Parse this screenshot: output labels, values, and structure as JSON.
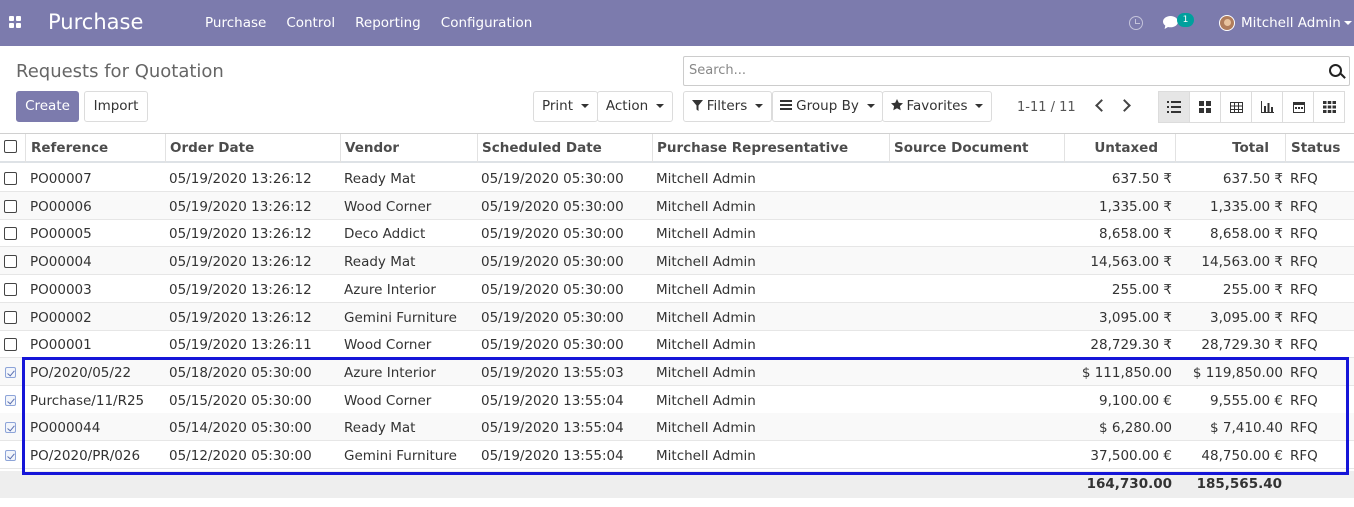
{
  "app": {
    "name": "Purchase",
    "menu": [
      "Purchase",
      "Control",
      "Reporting",
      "Configuration"
    ],
    "user": "Mitchell Admin",
    "chat_badge": "1",
    "brand_color": "#7c7bad"
  },
  "page": {
    "title": "Requests for Quotation",
    "create_label": "Create",
    "import_label": "Import",
    "print_label": "Print",
    "action_label": "Action",
    "search_placeholder": "Search...",
    "filters_label": "Filters",
    "groupby_label": "Group By",
    "favorites_label": "Favorites",
    "pager": "1-11 / 11"
  },
  "table": {
    "columns": [
      "Reference",
      "Order Date",
      "Vendor",
      "Scheduled Date",
      "Purchase Representative",
      "Source Document",
      "Untaxed",
      "Total",
      "Status"
    ],
    "rows": [
      {
        "ref": "PO00007",
        "order_date": "05/19/2020 13:26:12",
        "vendor": "Ready Mat",
        "scheduled": "05/19/2020 05:30:00",
        "rep": "Mitchell Admin",
        "source": "",
        "untaxed": "637.50 ₹",
        "total": "637.50 ₹",
        "status": "RFQ",
        "checked": false
      },
      {
        "ref": "PO00006",
        "order_date": "05/19/2020 13:26:12",
        "vendor": "Wood Corner",
        "scheduled": "05/19/2020 05:30:00",
        "rep": "Mitchell Admin",
        "source": "",
        "untaxed": "1,335.00 ₹",
        "total": "1,335.00 ₹",
        "status": "RFQ",
        "checked": false
      },
      {
        "ref": "PO00005",
        "order_date": "05/19/2020 13:26:12",
        "vendor": "Deco Addict",
        "scheduled": "05/19/2020 05:30:00",
        "rep": "Mitchell Admin",
        "source": "",
        "untaxed": "8,658.00 ₹",
        "total": "8,658.00 ₹",
        "status": "RFQ",
        "checked": false
      },
      {
        "ref": "PO00004",
        "order_date": "05/19/2020 13:26:12",
        "vendor": "Ready Mat",
        "scheduled": "05/19/2020 05:30:00",
        "rep": "Mitchell Admin",
        "source": "",
        "untaxed": "14,563.00 ₹",
        "total": "14,563.00 ₹",
        "status": "RFQ",
        "checked": false
      },
      {
        "ref": "PO00003",
        "order_date": "05/19/2020 13:26:12",
        "vendor": "Azure Interior",
        "scheduled": "05/19/2020 05:30:00",
        "rep": "Mitchell Admin",
        "source": "",
        "untaxed": "255.00 ₹",
        "total": "255.00 ₹",
        "status": "RFQ",
        "checked": false
      },
      {
        "ref": "PO00002",
        "order_date": "05/19/2020 13:26:12",
        "vendor": "Gemini Furniture",
        "scheduled": "05/19/2020 05:30:00",
        "rep": "Mitchell Admin",
        "source": "",
        "untaxed": "3,095.00 ₹",
        "total": "3,095.00 ₹",
        "status": "RFQ",
        "checked": false
      },
      {
        "ref": "PO00001",
        "order_date": "05/19/2020 13:26:11",
        "vendor": "Wood Corner",
        "scheduled": "05/19/2020 05:30:00",
        "rep": "Mitchell Admin",
        "source": "",
        "untaxed": "28,729.30 ₹",
        "total": "28,729.30 ₹",
        "status": "RFQ",
        "checked": false
      },
      {
        "ref": "PO/2020/05/22",
        "order_date": "05/18/2020 05:30:00",
        "vendor": "Azure Interior",
        "scheduled": "05/19/2020 13:55:03",
        "rep": "Mitchell Admin",
        "source": "",
        "untaxed": "$ 111,850.00",
        "total": "$ 119,850.00",
        "status": "RFQ",
        "checked": true
      },
      {
        "ref": "Purchase/11/R25",
        "order_date": "05/15/2020 05:30:00",
        "vendor": "Wood Corner",
        "scheduled": "05/19/2020 13:55:04",
        "rep": "Mitchell Admin",
        "source": "",
        "untaxed": "9,100.00 €",
        "total": "9,555.00 €",
        "status": "RFQ",
        "checked": true
      },
      {
        "ref": "PO000044",
        "order_date": "05/14/2020 05:30:00",
        "vendor": "Ready Mat",
        "scheduled": "05/19/2020 13:55:04",
        "rep": "Mitchell Admin",
        "source": "",
        "untaxed": "$ 6,280.00",
        "total": "$ 7,410.40",
        "status": "RFQ",
        "checked": true
      },
      {
        "ref": "PO/2020/PR/026",
        "order_date": "05/12/2020 05:30:00",
        "vendor": "Gemini Furniture",
        "scheduled": "05/19/2020 13:55:04",
        "rep": "Mitchell Admin",
        "source": "",
        "untaxed": "37,500.00 €",
        "total": "48,750.00 €",
        "status": "RFQ",
        "checked": true
      }
    ],
    "totals": {
      "untaxed": "164,730.00",
      "total": "185,565.40"
    }
  }
}
